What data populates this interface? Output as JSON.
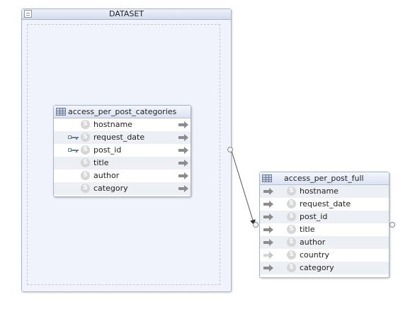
{
  "dataset": {
    "title": "DATASET",
    "icon": "dataset-icon"
  },
  "source_table": {
    "name": "access_per_post_categories",
    "columns": [
      {
        "name": "hostname",
        "key": false,
        "type_icon": "S",
        "arrow": "solid"
      },
      {
        "name": "request_date",
        "key": true,
        "type_icon": "S",
        "arrow": "solid"
      },
      {
        "name": "post_id",
        "key": true,
        "type_icon": "S",
        "arrow": "solid"
      },
      {
        "name": "title",
        "key": false,
        "type_icon": "S",
        "arrow": "solid"
      },
      {
        "name": "author",
        "key": false,
        "type_icon": "S",
        "arrow": "solid"
      },
      {
        "name": "category",
        "key": false,
        "type_icon": "S",
        "arrow": "solid"
      }
    ]
  },
  "target_table": {
    "name": "access_per_post_full",
    "columns": [
      {
        "name": "hostname",
        "type_icon": "S",
        "arrow": "solid"
      },
      {
        "name": "request_date",
        "type_icon": "S",
        "arrow": "solid"
      },
      {
        "name": "post_id",
        "type_icon": "S",
        "arrow": "solid"
      },
      {
        "name": "title",
        "type_icon": "S",
        "arrow": "solid"
      },
      {
        "name": "author",
        "type_icon": "S",
        "arrow": "solid"
      },
      {
        "name": "country",
        "type_icon": "S",
        "arrow": "hollow"
      },
      {
        "name": "category",
        "type_icon": "S",
        "arrow": "solid"
      }
    ]
  },
  "colors": {
    "dataset_bg": "#f0f3fb",
    "border": "#a9b4c6",
    "alt_row": "#eceff3",
    "arrow": "#8c8c8c"
  }
}
